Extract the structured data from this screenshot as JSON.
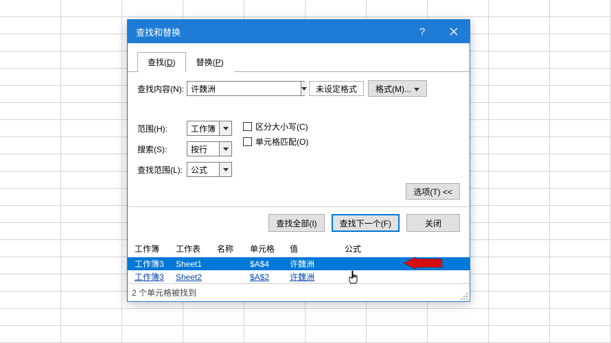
{
  "titlebar": {
    "title": "查找和替换"
  },
  "tabs": {
    "find": {
      "label": "查找(",
      "hotkey": "D",
      "suffix": ")"
    },
    "replace": {
      "label": "替换(",
      "hotkey": "P",
      "suffix": ")"
    }
  },
  "find": {
    "content_label": "查找内容(N):",
    "content_value": "许魏洲",
    "format_preview": "未设定格式",
    "format_btn": "格式(M)..."
  },
  "options": {
    "range_label": "范围(H):",
    "range_value": "工作簿",
    "search_label": "搜索(S):",
    "search_value": "按行",
    "lookin_label": "查找范围(L):",
    "lookin_value": "公式",
    "match_case": "区分大小写(C)",
    "match_cell": "单元格匹配(O)",
    "options_btn": "选项(T) <<"
  },
  "actions": {
    "find_all": "查找全部(I)",
    "find_next": "查找下一个(F)",
    "close": "关闭"
  },
  "results": {
    "headers": {
      "workbook": "工作簿",
      "worksheet": "工作表",
      "name": "名称",
      "cell": "单元格",
      "value": "值",
      "formula": "公式"
    },
    "rows": [
      {
        "workbook": "工作簿3",
        "worksheet": "Sheet1",
        "name": "",
        "cell": "$A$4",
        "value": "许魏洲",
        "formula": ""
      },
      {
        "workbook": "工作簿3",
        "worksheet": "Sheet2",
        "name": "",
        "cell": "$A$2",
        "value": "许魏洲",
        "formula": ""
      }
    ],
    "status": "2 个单元格被找到"
  }
}
